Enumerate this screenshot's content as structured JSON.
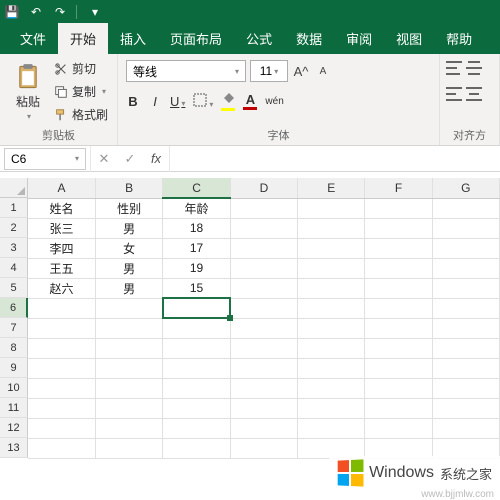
{
  "qat": {
    "save": "💾",
    "undo": "↶",
    "redo": "↷"
  },
  "tabs": [
    "文件",
    "开始",
    "插入",
    "页面布局",
    "公式",
    "数据",
    "审阅",
    "视图",
    "帮助"
  ],
  "active_tab_index": 1,
  "clipboard": {
    "paste": "粘贴",
    "cut": "剪切",
    "copy": "复制",
    "format_painter": "格式刷",
    "group_label": "剪贴板"
  },
  "font": {
    "name": "等线",
    "size": "11",
    "increase": "A",
    "decrease": "A",
    "bold": "B",
    "italic": "I",
    "underline": "U",
    "phonetic": "wén",
    "group_label": "字体",
    "fill_color": "#ffff00",
    "font_color": "#c00000"
  },
  "align": {
    "group_label": "对齐方"
  },
  "name_box": "C6",
  "formula_bar": {
    "cancel": "✕",
    "enter": "✓",
    "fx": "fx",
    "value": ""
  },
  "columns": [
    "A",
    "B",
    "C",
    "D",
    "E",
    "F",
    "G"
  ],
  "active_col_index": 2,
  "active_row_index": 5,
  "row_count": 13,
  "table": {
    "headers": [
      "姓名",
      "性别",
      "年龄"
    ],
    "rows": [
      [
        "张三",
        "男",
        "18"
      ],
      [
        "李四",
        "女",
        "17"
      ],
      [
        "王五",
        "男",
        "19"
      ],
      [
        "赵六",
        "男",
        "15"
      ]
    ]
  },
  "watermark": {
    "brand": "Windows",
    "tagline": "系统之家",
    "url": "www.bjjmlw.com"
  }
}
